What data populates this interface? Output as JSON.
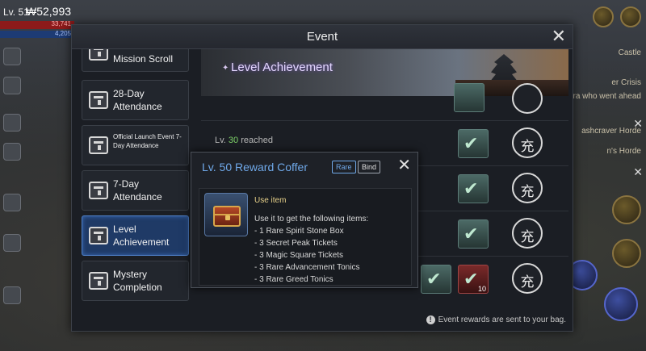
{
  "hud": {
    "level": "Lv. 51",
    "power": "₩52,993",
    "hp": "33,741",
    "mp": "4,205"
  },
  "dialog": {
    "title": "Event",
    "footer_note": "Event rewards are sent to your bag."
  },
  "sidebar": {
    "items": [
      {
        "label": "Mission Scroll",
        "active": false
      },
      {
        "label": "28-Day Attendance",
        "active": false
      },
      {
        "label": "Official Launch Event  7-Day Attendance",
        "active": false
      },
      {
        "label": "7-Day Attendance",
        "active": false
      },
      {
        "label": "Level Achievement",
        "active": true
      },
      {
        "label": "Mystery Completion",
        "active": false
      }
    ]
  },
  "main": {
    "banner_title": "Level Achievement",
    "banner_star": "✦",
    "row_req_prefix": "Lv. ",
    "row_req_level": "30",
    "row_req_suffix": " reached",
    "claim_glyph": "充",
    "check_glyph": "✔",
    "rare_item_qty": "10"
  },
  "popup": {
    "title": "Lv. 50 Reward Coffer",
    "badge_rare": "Rare",
    "badge_bind": "Bind",
    "use_item": "Use item",
    "desc_intro": "Use it to get the following items:",
    "items": [
      "- 1 Rare Spirit Stone Box",
      "- 3 Secret Peak Tickets",
      "- 3 Magic Square Tickets",
      "- 3 Rare Advancement Tonics",
      "- 3 Rare Greed Tonics"
    ]
  },
  "right_hud": {
    "quests": [
      "Castle",
      "er Crisis",
      "ra who went ahead",
      "ashcraver Horde",
      "n's Horde"
    ]
  },
  "colors": {
    "accent_blue": "#6fa8e8",
    "active_tab": "#1f3a66",
    "level_green": "#7fd36a",
    "banner_purple": "#e4d7ff"
  }
}
